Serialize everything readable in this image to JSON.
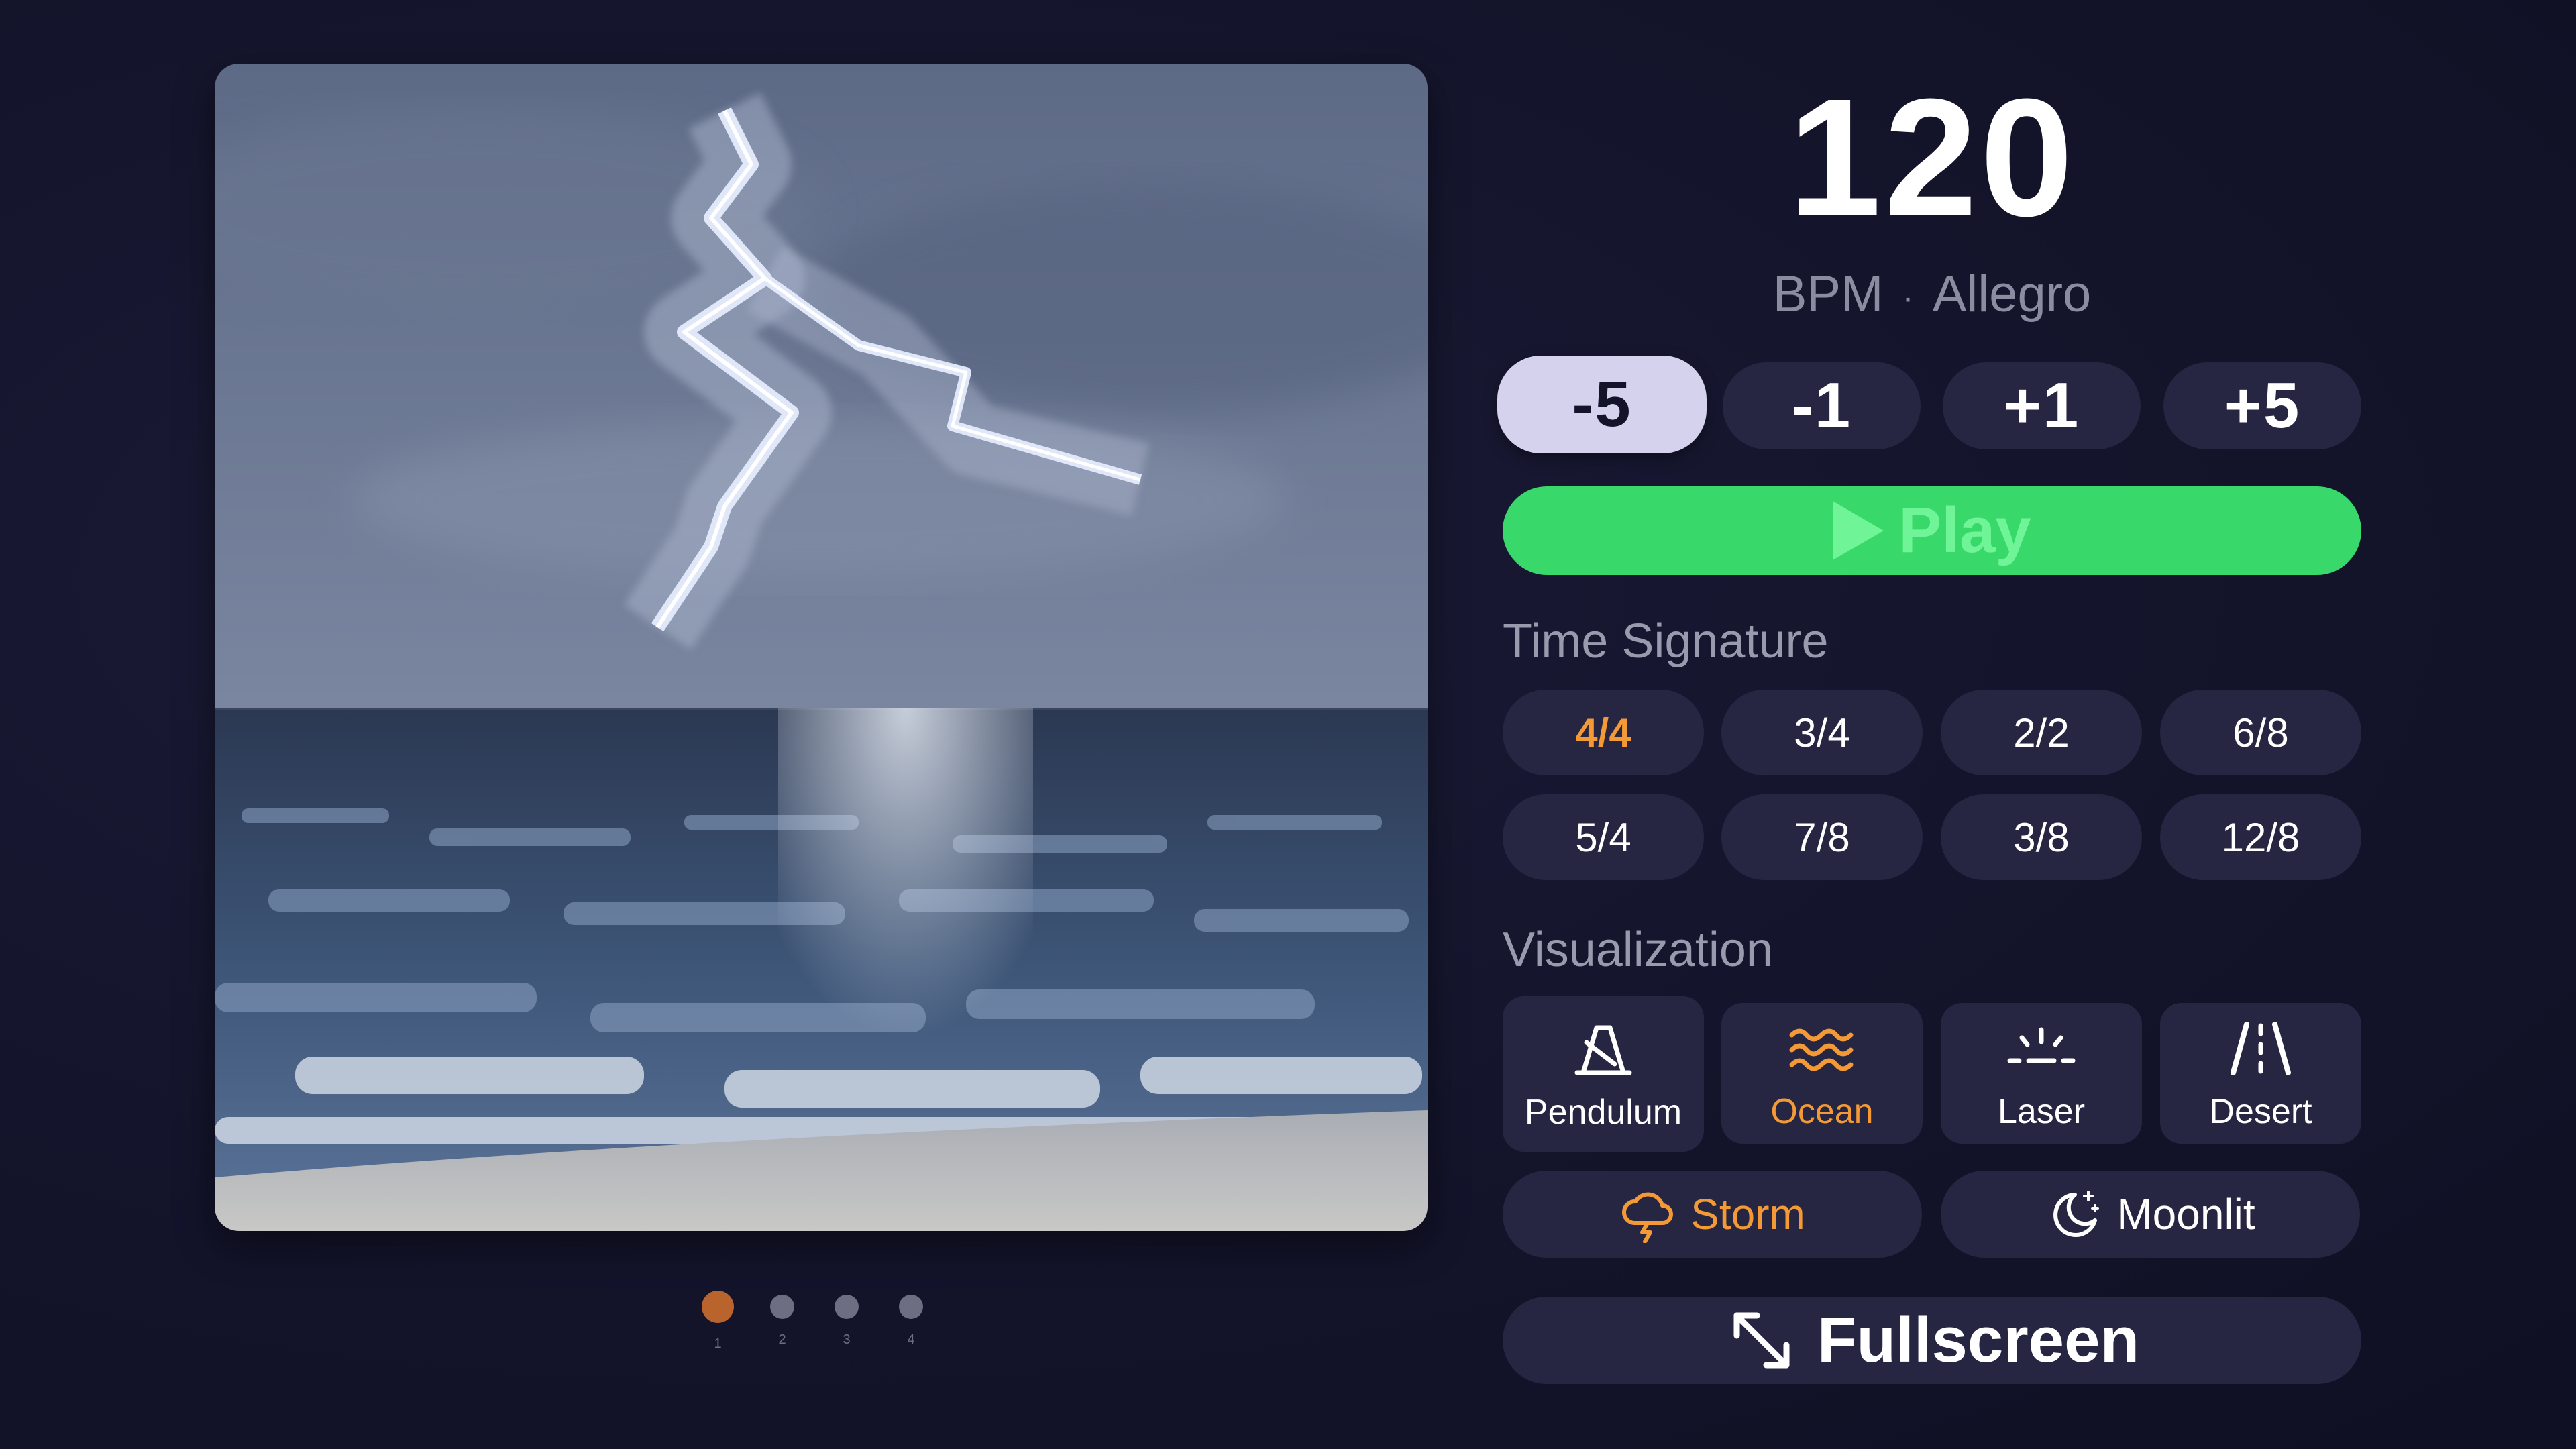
{
  "tempo": {
    "bpm": "120",
    "unit": "BPM",
    "separator": "·",
    "marking": "Allegro"
  },
  "steps": [
    {
      "label": "-5",
      "selected": true
    },
    {
      "label": "-1",
      "selected": false
    },
    {
      "label": "+1",
      "selected": false
    },
    {
      "label": "+5",
      "selected": false
    }
  ],
  "play": {
    "label": "Play",
    "icon": "play-icon"
  },
  "time_signature": {
    "title": "Time Signature",
    "options": [
      "4/4",
      "3/4",
      "2/2",
      "6/8",
      "5/4",
      "7/8",
      "3/8",
      "12/8"
    ],
    "selected": "4/4"
  },
  "visualization": {
    "title": "Visualization",
    "cards": [
      {
        "label": "Pendulum",
        "icon": "metronome-icon"
      },
      {
        "label": "Ocean",
        "icon": "waves-icon",
        "selected": true
      },
      {
        "label": "Laser",
        "icon": "sunrise-rays-icon"
      },
      {
        "label": "Desert",
        "icon": "road-icon"
      }
    ],
    "wide": [
      {
        "label": "Storm",
        "icon": "cloud-lightning-icon",
        "selected": true
      },
      {
        "label": "Moonlit",
        "icon": "moon-stars-icon"
      }
    ]
  },
  "fullscreen": {
    "label": "Fullscreen",
    "icon": "expand-arrows-icon"
  },
  "pager": {
    "pages": [
      "1",
      "2",
      "3",
      "4"
    ],
    "active": "1"
  },
  "colors": {
    "background": "#13132a",
    "button": "#262642",
    "accent_orange": "#f39a36",
    "play_green": "#39d86a",
    "selected_step": "#d4d2ec",
    "active_dot": "#b8642c"
  }
}
